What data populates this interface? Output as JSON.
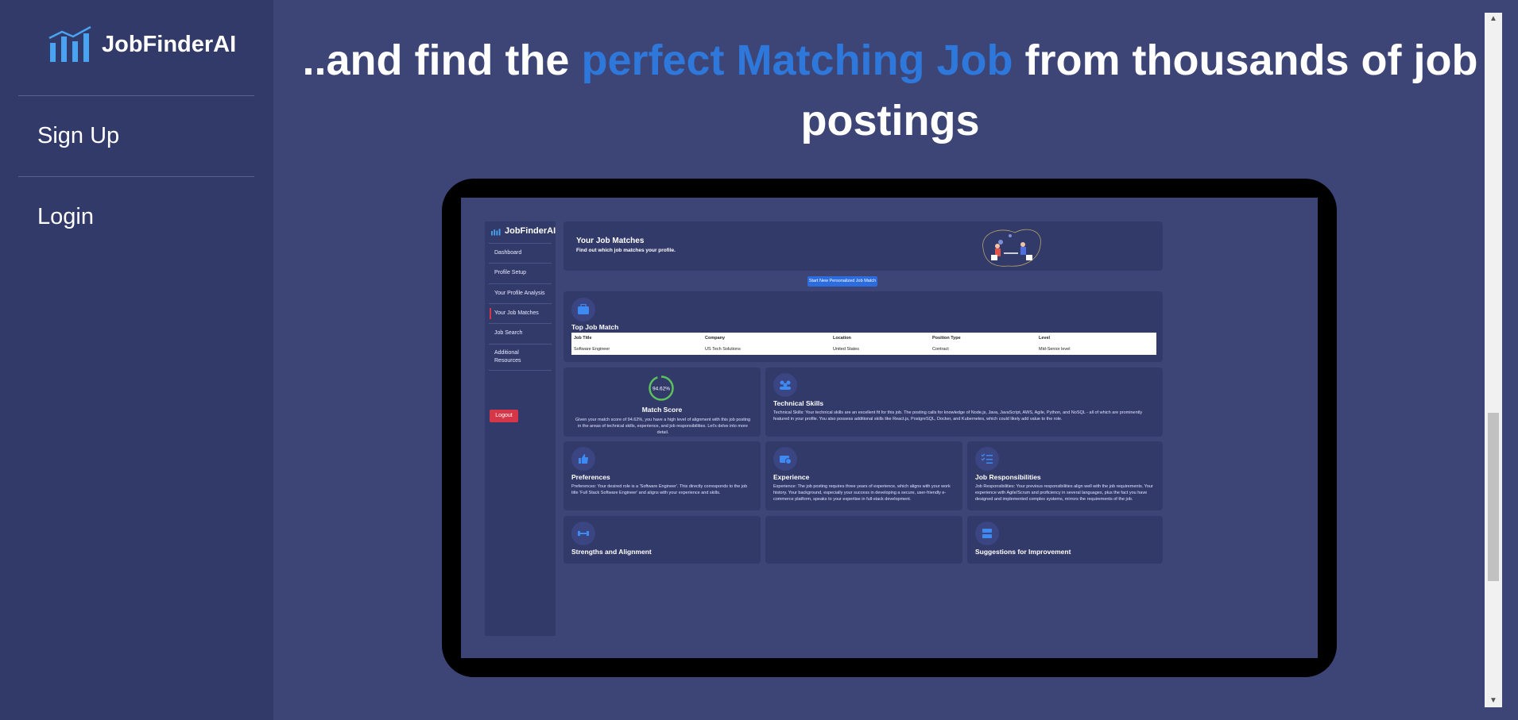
{
  "sidebar": {
    "brand": "JobFinderAI",
    "items": [
      {
        "label": "Sign Up"
      },
      {
        "label": "Login"
      }
    ]
  },
  "headline": {
    "before": "..and find the ",
    "highlight": "perfect Matching Job",
    "after": " from thousands of job postings"
  },
  "colors": {
    "page_bg": "#3d4577",
    "sidebar_bg": "#323a6a",
    "accent": "#2e78db",
    "danger": "#d63748"
  },
  "preview": {
    "brand": "JobFinderAI",
    "nav": [
      "Dashboard",
      "Profile Setup",
      "Your Profile Analysis",
      "Your Job Matches",
      "Job Search",
      "Additional",
      "Resources"
    ],
    "active": "Your Job Matches",
    "logout": "Logout",
    "header": {
      "title": "Your Job Matches",
      "subtitle": "Find out which job matches your profile."
    },
    "start_button": "Start New Personalized Job Match",
    "top_match": {
      "title": "Top Job Match",
      "columns": [
        "Job Title",
        "Company",
        "Location",
        "Position Type",
        "Level"
      ],
      "row": [
        "Software Engineer",
        "US Tech Solutions",
        "United States",
        "Contract",
        "Mid-Senior level"
      ]
    },
    "match_score": {
      "value": 94.62,
      "label": "94.62%",
      "title": "Match Score",
      "text": "Given your match score of 94.62%, you have a high level of alignment with this job posting in the areas of technical skills, experience, and job responsibilities. Let's delve into more detail."
    },
    "technical_skills": {
      "title": "Technical Skills",
      "text": "Technical Skills: Your technical skills are an excellent fit for this job. The posting calls for knowledge of Node.js, Java, JavaScript, AWS, Agile, Python, and NoSQL - all of which are prominently featured in your profile. You also possess additional skills like React.js, PostgreSQL, Docker, and Kubernetes, which could likely add value to the role."
    },
    "preferences": {
      "title": "Preferences",
      "text": "Preferences: Your desired role is a 'Software Engineer'. This directly corresponds to the job title 'Full Stack Software Engineer' and aligns with your experience and skills."
    },
    "experience": {
      "title": "Experience",
      "text": "Experience: The job posting requires three years of experience, which aligns with your work history. Your background, especially your success in developing a secure, user-friendly e-commerce platform, speaks to your expertise in full-stack development."
    },
    "responsibilities": {
      "title": "Job Responsibilities",
      "text": "Job Responsibilities: Your previous responsibilities align well with the job requirements. Your experience with Agile/Scrum and proficiency in several languages, plus the fact you have designed and implemented complex systems, mirrors the requirements of the job."
    },
    "strengths": {
      "title": "Strengths and Alignment"
    },
    "suggestions": {
      "title": "Suggestions for Improvement"
    }
  }
}
